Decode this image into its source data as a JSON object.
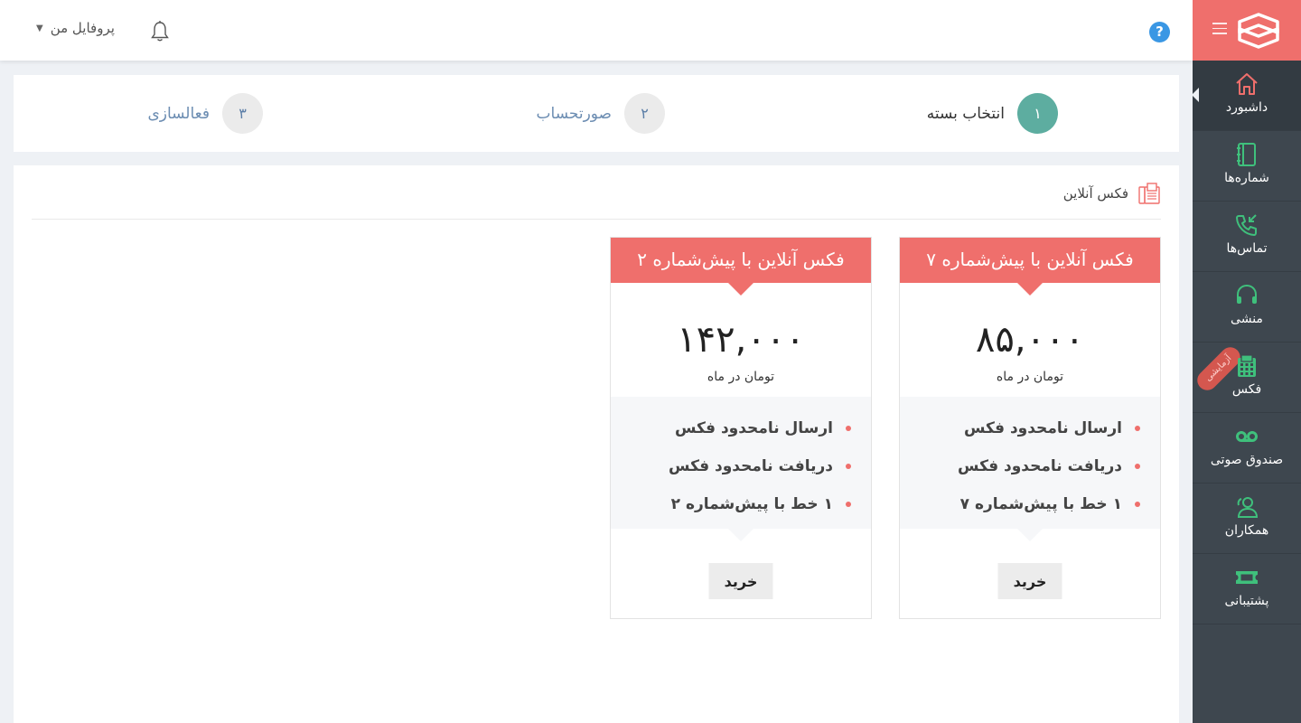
{
  "header": {
    "profile_label": "پروفایل من",
    "profile_caret": "▼",
    "help_label": "?"
  },
  "sidebar": {
    "items": [
      {
        "label": "داشبورد",
        "icon": "home-icon",
        "active": true
      },
      {
        "label": "شماره‌ها",
        "icon": "notebook-icon"
      },
      {
        "label": "تماس‌ها",
        "icon": "phone-incoming-icon"
      },
      {
        "label": "منشی",
        "icon": "headset-icon"
      },
      {
        "label": "فکس",
        "icon": "fax-icon",
        "badge": "آزمایشی"
      },
      {
        "label": "صندوق صوتی",
        "icon": "voicemail-icon"
      },
      {
        "label": "همکاران",
        "icon": "users-icon"
      },
      {
        "label": "پشتیبانی",
        "icon": "ticket-icon"
      }
    ]
  },
  "steps": [
    {
      "num": "۱",
      "label": "انتخاب بسته",
      "current": true
    },
    {
      "num": "۲",
      "label": "صورتحساب"
    },
    {
      "num": "۳",
      "label": "فعالسازی"
    }
  ],
  "section": {
    "title": "فکس آنلاین"
  },
  "plans": [
    {
      "title": "فکس آنلاین با پیش‌شماره ۷",
      "price": "۸۵,۰۰۰",
      "period": "تومان در ماه",
      "features": [
        "ارسال نامحدود فکس",
        "دریافت نامحدود فکس",
        "۱ خط با پیش‌شماره ۷"
      ],
      "buy_label": "خرید"
    },
    {
      "title": "فکس آنلاین با پیش‌شماره ۲",
      "price": "۱۴۲,۰۰۰",
      "period": "تومان در ماه",
      "features": [
        "ارسال نامحدود فکس",
        "دریافت نامحدود فکس",
        "۱ خط با پیش‌شماره ۲"
      ],
      "buy_label": "خرید"
    }
  ],
  "colors": {
    "accent": "#ef6f6c",
    "sidebar_bg": "#3e474f",
    "icon_green": "#3fc07c",
    "step_active": "#5dada0",
    "help_blue": "#3a97e4"
  }
}
